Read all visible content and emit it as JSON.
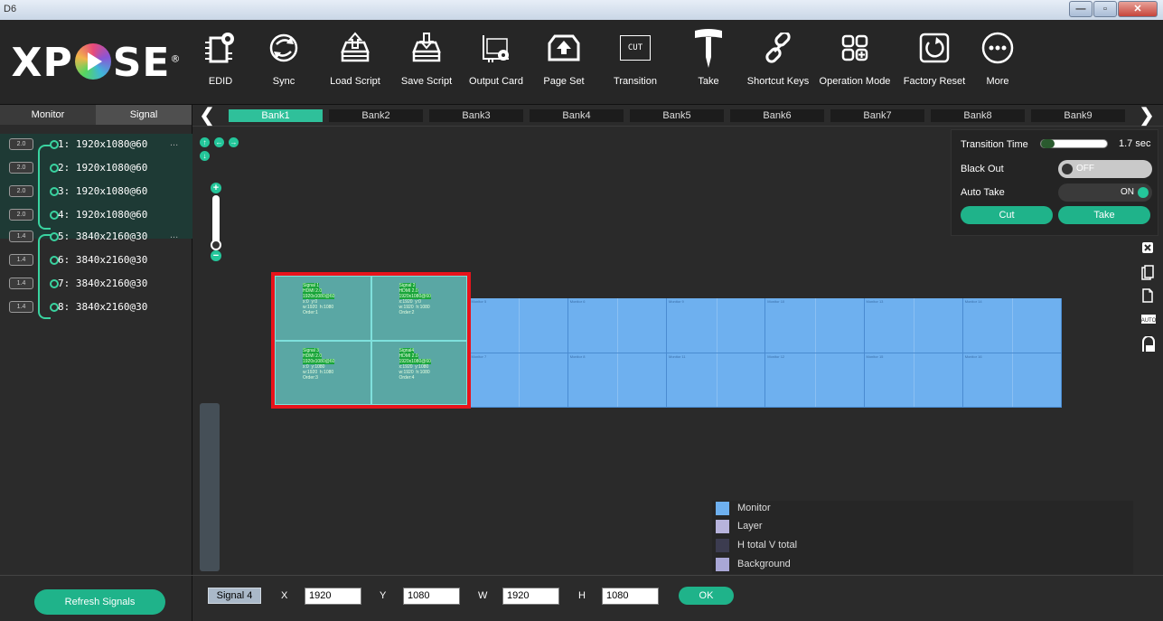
{
  "window": {
    "title": "D6"
  },
  "logo": {
    "text_left": "X",
    "text_right": "SE",
    "text_p": "P",
    "reg": "®"
  },
  "toolbar": {
    "items": [
      {
        "label": "EDID",
        "icon": "chip-gear-icon"
      },
      {
        "label": "Sync",
        "icon": "sync-icon"
      },
      {
        "label": "Load Script",
        "icon": "load-script-icon"
      },
      {
        "label": "Save Script",
        "icon": "save-script-icon"
      },
      {
        "label": "Output Card",
        "icon": "output-card-icon"
      },
      {
        "label": "Page Set",
        "icon": "page-set-icon"
      },
      {
        "label": "Transition",
        "icon": "transition-icon",
        "badge": "CUT"
      },
      {
        "label": "Take",
        "icon": "take-lever-icon"
      },
      {
        "label": "Shortcut Keys",
        "icon": "link-icon"
      },
      {
        "label": "Operation Mode",
        "icon": "operation-mode-icon"
      },
      {
        "label": "Factory Reset",
        "icon": "factory-reset-icon"
      },
      {
        "label": "More",
        "icon": "more-icon"
      }
    ]
  },
  "left": {
    "tabs": [
      "Monitor",
      "Signal"
    ],
    "signals": [
      {
        "badge": "2.0",
        "label": "1: 1920x1080@60",
        "more": "..."
      },
      {
        "badge": "2.0",
        "label": "2: 1920x1080@60"
      },
      {
        "badge": "2.0",
        "label": "3: 1920x1080@60"
      },
      {
        "badge": "2.0",
        "label": "4: 1920x1080@60"
      },
      {
        "badge": "1.4",
        "label": "5: 3840x2160@30",
        "more": "..."
      },
      {
        "badge": "1.4",
        "label": "6: 3840x2160@30"
      },
      {
        "badge": "1.4",
        "label": "7: 3840x2160@30"
      },
      {
        "badge": "1.4",
        "label": "8: 3840x2160@30"
      }
    ],
    "refresh_label": "Refresh Signals"
  },
  "banks": {
    "prev": "❮",
    "next": "❯",
    "items": [
      "Bank1",
      "Bank2",
      "Bank3",
      "Bank4",
      "Bank5",
      "Bank6",
      "Bank7",
      "Bank8",
      "Bank9"
    ],
    "active": "Bank1"
  },
  "canvas": {
    "layers": [
      {
        "l1": "Signal 1",
        "l2": "HDMI 2.0",
        "l3": "1920x1080@60",
        "l4": "x:0  y:0",
        "l5": "w:1920  h:1080",
        "l6": "Order:1"
      },
      {
        "l1": "Signal 2",
        "l2": "HDMI 2.0",
        "l3": "1920x1080@60",
        "l4": "x:1920  y:0",
        "l5": "w:1920  h:1080",
        "l6": "Order:2"
      },
      {
        "l1": "Signal 3",
        "l2": "HDMI 2.0",
        "l3": "1920x1080@60",
        "l4": "x:0  y:1080",
        "l5": "w:1920  h:1080",
        "l6": "Order:3"
      },
      {
        "l1": "Signal4",
        "l2": "HDMI 2.0",
        "l3": "1920x1080@60",
        "l4": "x:1920  y:1080",
        "l5": "w:1920  h:1080",
        "l6": "Order:4"
      }
    ],
    "monitors_top": [
      "Monitor 5",
      "Monitor 6",
      "Monitor 9",
      "Monitor 10",
      "Monitor 13",
      "Monitor 14"
    ],
    "monitors_bottom": [
      "Monitor 7",
      "Monitor 8",
      "Monitor 11",
      "Monitor 12",
      "Monitor 15",
      "Monitor 16"
    ]
  },
  "transition": {
    "time_label": "Transition Time",
    "time_value": "1.7 sec",
    "time_fraction": 0.2,
    "blackout_label": "Black Out",
    "blackout_state": "OFF",
    "autotake_label": "Auto Take",
    "autotake_state": "ON",
    "cut_label": "Cut",
    "take_label": "Take"
  },
  "side_icons": [
    "close-box-icon",
    "copy-icon",
    "paste-icon",
    "auto-icon",
    "on-icon"
  ],
  "legend": {
    "items": [
      {
        "label": "Monitor",
        "color": "#6eb0ef"
      },
      {
        "label": "Layer",
        "color": "#b7b3dc"
      },
      {
        "label": "H total V total",
        "color": "#3c3c50"
      },
      {
        "label": "Background",
        "color": "#a9a7d6"
      }
    ]
  },
  "bottom": {
    "signal_label": "Signal 4",
    "x_label": "X",
    "x_value": "1920",
    "y_label": "Y",
    "y_value": "1080",
    "w_label": "W",
    "w_value": "1920",
    "h_label": "H",
    "h_value": "1080",
    "ok_label": "OK"
  }
}
